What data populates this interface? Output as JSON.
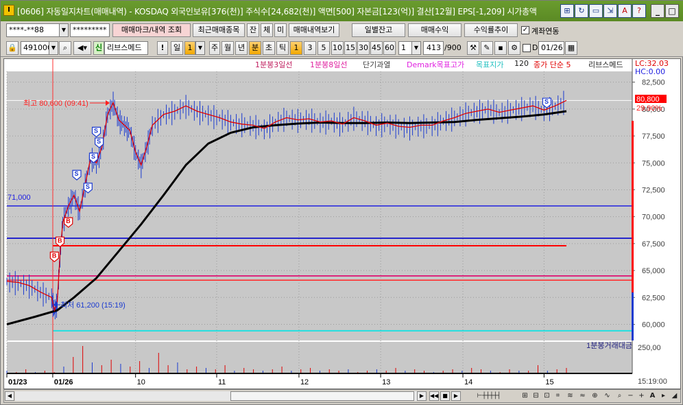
{
  "window": {
    "app_icon": "I",
    "title": "[0606] 자동일지차트(매매내역) - KOSDAQ 외국인보유[376(천)] 주식수[24,682(천)] 액면[500] 자본금[123(억)] 결산[12월] EPS[-1,209] 시가총액"
  },
  "toolbar1": {
    "account": "****-**88",
    "password": "*********",
    "trade_mark_label": "매매마크/내역 조회",
    "recent_trades_label": "최근매매종목",
    "jan_label": "잔",
    "che_label": "체",
    "mi_label": "미",
    "trade_history_label": "매매내역보기",
    "daily_balance_label": "일별잔고",
    "trade_profit_label": "매매수익",
    "return_trend_label": "수익률추이",
    "account_link_label": "계좌연동",
    "account_link_checked": "✓"
  },
  "toolbar2": {
    "code": "491000",
    "news_label": "신",
    "stock_name": "리브스메드",
    "mark": "!",
    "period_day": "일",
    "period_value": "1",
    "week": "주",
    "month": "월",
    "year": "년",
    "minute": "분",
    "sec": "초",
    "tick": "틱",
    "intervals": [
      "1",
      "3",
      "5",
      "10",
      "15",
      "30",
      "45",
      "60"
    ],
    "interval_count": "1",
    "view_count": "413",
    "view_total": "/900",
    "d_label": "D",
    "date": "01/26"
  },
  "chart_header": {
    "ma3": "1분봉3일선",
    "ma8": "1분봉8일선",
    "overheat": "단기과열",
    "demark": "Demark목표고가",
    "target": "목표지가",
    "ma120_num": "120",
    "close_simple": "종가 단순 5",
    "stock": "리브스메드",
    "lc": "LC:32.03",
    "hc": "HC:0.00"
  },
  "chart_data": {
    "type": "line",
    "x": [
      "01/23",
      "01/26",
      "10",
      "11",
      "12",
      "13",
      "14",
      "15"
    ],
    "price_axis": [
      "82,500",
      "80,000",
      "77,500",
      "75,000",
      "72,500",
      "70,000",
      "67,500",
      "65,000",
      "62,500",
      "60,000"
    ],
    "ylim": [
      58500,
      83500
    ],
    "current_price": "80,800",
    "current_pct": "29.90%",
    "high_annotation": "최고 80,600 (09:41)",
    "low_annotation": "최저 61,200 (15:19)",
    "line_71000_label": "71,000",
    "volume_axis": "250,00",
    "volume_label": "1분봉거래대금",
    "time_label": "15:19:00",
    "price_series": [
      {
        "x": 0.0,
        "y": 64000
      },
      {
        "x": 0.02,
        "y": 63900
      },
      {
        "x": 0.04,
        "y": 63600
      },
      {
        "x": 0.06,
        "y": 63000
      },
      {
        "x": 0.08,
        "y": 62500
      },
      {
        "x": 0.085,
        "y": 61300
      },
      {
        "x": 0.09,
        "y": 62000
      },
      {
        "x": 0.095,
        "y": 66500
      },
      {
        "x": 0.1,
        "y": 69500
      },
      {
        "x": 0.11,
        "y": 71000
      },
      {
        "x": 0.12,
        "y": 72000
      },
      {
        "x": 0.13,
        "y": 70500
      },
      {
        "x": 0.14,
        "y": 73000
      },
      {
        "x": 0.15,
        "y": 75500
      },
      {
        "x": 0.16,
        "y": 75000
      },
      {
        "x": 0.17,
        "y": 76500
      },
      {
        "x": 0.18,
        "y": 79500
      },
      {
        "x": 0.19,
        "y": 80600
      },
      {
        "x": 0.2,
        "y": 79000
      },
      {
        "x": 0.21,
        "y": 78500
      },
      {
        "x": 0.22,
        "y": 78000
      },
      {
        "x": 0.23,
        "y": 76000
      },
      {
        "x": 0.24,
        "y": 74800
      },
      {
        "x": 0.25,
        "y": 76500
      },
      {
        "x": 0.26,
        "y": 78500
      },
      {
        "x": 0.28,
        "y": 79500
      },
      {
        "x": 0.3,
        "y": 79800
      },
      {
        "x": 0.32,
        "y": 80300
      },
      {
        "x": 0.34,
        "y": 79800
      },
      {
        "x": 0.36,
        "y": 79500
      },
      {
        "x": 0.38,
        "y": 79200
      },
      {
        "x": 0.4,
        "y": 78800
      },
      {
        "x": 0.42,
        "y": 78600
      },
      {
        "x": 0.44,
        "y": 78500
      },
      {
        "x": 0.46,
        "y": 78200
      },
      {
        "x": 0.48,
        "y": 78800
      },
      {
        "x": 0.5,
        "y": 79200
      },
      {
        "x": 0.52,
        "y": 79000
      },
      {
        "x": 0.54,
        "y": 79100
      },
      {
        "x": 0.56,
        "y": 78800
      },
      {
        "x": 0.58,
        "y": 78900
      },
      {
        "x": 0.6,
        "y": 78600
      },
      {
        "x": 0.62,
        "y": 79200
      },
      {
        "x": 0.64,
        "y": 78900
      },
      {
        "x": 0.66,
        "y": 78500
      },
      {
        "x": 0.68,
        "y": 78700
      },
      {
        "x": 0.7,
        "y": 78400
      },
      {
        "x": 0.72,
        "y": 78300
      },
      {
        "x": 0.74,
        "y": 78500
      },
      {
        "x": 0.76,
        "y": 78500
      },
      {
        "x": 0.78,
        "y": 78900
      },
      {
        "x": 0.8,
        "y": 79200
      },
      {
        "x": 0.82,
        "y": 79600
      },
      {
        "x": 0.84,
        "y": 79800
      },
      {
        "x": 0.86,
        "y": 80000
      },
      {
        "x": 0.88,
        "y": 79700
      },
      {
        "x": 0.9,
        "y": 79900
      },
      {
        "x": 0.92,
        "y": 80100
      },
      {
        "x": 0.94,
        "y": 80300
      },
      {
        "x": 0.96,
        "y": 79900
      },
      {
        "x": 0.98,
        "y": 80300
      },
      {
        "x": 1.0,
        "y": 80800
      }
    ],
    "ma_series": [
      {
        "x": 0.0,
        "y": 60000
      },
      {
        "x": 0.05,
        "y": 60700
      },
      {
        "x": 0.09,
        "y": 61300
      },
      {
        "x": 0.12,
        "y": 62500
      },
      {
        "x": 0.16,
        "y": 64300
      },
      {
        "x": 0.2,
        "y": 66800
      },
      {
        "x": 0.24,
        "y": 69300
      },
      {
        "x": 0.28,
        "y": 72000
      },
      {
        "x": 0.32,
        "y": 74800
      },
      {
        "x": 0.36,
        "y": 76800
      },
      {
        "x": 0.4,
        "y": 77800
      },
      {
        "x": 0.44,
        "y": 78300
      },
      {
        "x": 0.48,
        "y": 78500
      },
      {
        "x": 0.52,
        "y": 78650
      },
      {
        "x": 0.56,
        "y": 78750
      },
      {
        "x": 0.6,
        "y": 78700
      },
      {
        "x": 0.64,
        "y": 78700
      },
      {
        "x": 0.68,
        "y": 78750
      },
      {
        "x": 0.72,
        "y": 78700
      },
      {
        "x": 0.76,
        "y": 78750
      },
      {
        "x": 0.8,
        "y": 78800
      },
      {
        "x": 0.84,
        "y": 79000
      },
      {
        "x": 0.88,
        "y": 79150
      },
      {
        "x": 0.92,
        "y": 79300
      },
      {
        "x": 0.96,
        "y": 79500
      },
      {
        "x": 1.0,
        "y": 79800
      }
    ],
    "hlines": [
      {
        "y": 71000,
        "color": "#2020e0"
      },
      {
        "y": 68000,
        "color": "#0000cc"
      },
      {
        "y": 67300,
        "color": "#ff0000"
      },
      {
        "y": 64500,
        "color": "#e0006a"
      },
      {
        "y": 64100,
        "color": "#ff3030"
      },
      {
        "y": 59400,
        "color": "#20e0e0"
      }
    ],
    "trade_marks": [
      {
        "type": "B",
        "x": 0.085,
        "y": 66200
      },
      {
        "type": "B",
        "x": 0.095,
        "y": 67600
      },
      {
        "type": "B",
        "x": 0.11,
        "y": 69400
      },
      {
        "type": "S",
        "x": 0.125,
        "y": 73800
      },
      {
        "type": "S",
        "x": 0.145,
        "y": 72600
      },
      {
        "type": "S",
        "x": 0.155,
        "y": 75400
      },
      {
        "type": "S",
        "x": 0.165,
        "y": 76800
      },
      {
        "type": "S",
        "x": 0.16,
        "y": 77800
      },
      {
        "type": "S",
        "x": 0.965,
        "y": 80500
      }
    ],
    "volume": [
      2,
      1,
      3,
      1,
      2,
      1,
      5,
      12,
      20,
      8,
      6,
      10,
      7,
      5,
      9,
      4,
      15,
      6,
      8,
      3,
      5,
      4,
      3,
      6,
      2,
      4,
      3,
      2,
      3,
      5,
      2,
      3,
      4,
      2,
      3,
      2,
      3,
      1,
      2,
      3,
      2,
      4,
      2,
      3,
      2,
      1,
      2,
      3,
      2,
      4,
      3,
      2,
      1,
      3,
      2,
      2,
      6,
      2,
      3,
      4
    ]
  },
  "colors": {
    "chart_bg": "#c8c8c8",
    "price_line": "#e00000",
    "ma_line": "#000000",
    "candle_blue": "#1a3ad0",
    "grid": "#9a9a9a",
    "axis_text": "#404040"
  }
}
